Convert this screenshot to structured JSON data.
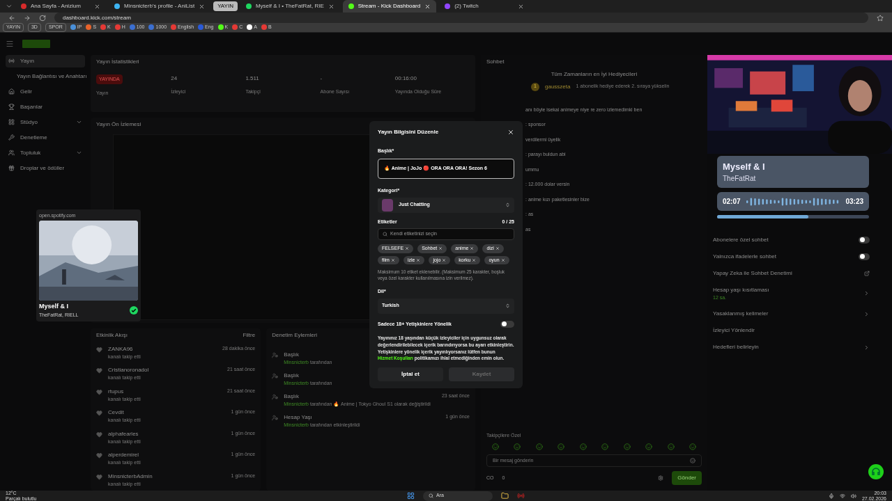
{
  "browser": {
    "tabs": [
      {
        "title": "Ana Sayfa - Anizium",
        "selected": false,
        "color": "#d62b2b"
      },
      {
        "title": "Minsnicterb's profile - AniList",
        "selected": false,
        "color": "#3db4f2"
      },
      {
        "title": "YAYIN",
        "kind": "group",
        "selected": false,
        "color": "#bbbbbb"
      },
      {
        "title": "Myself & I • TheFatRat, RIE",
        "selected": false,
        "color": "#1ed760"
      },
      {
        "title": "Stream - Kick Dashboard",
        "selected": true,
        "color": "#53fc18"
      },
      {
        "title": "(2) Twitch",
        "selected": false,
        "color": "#9146ff"
      }
    ],
    "address": "dashboard.kick.com/stream",
    "bookmarks": [
      {
        "label": "YAYIN",
        "kind": "folder"
      },
      {
        "label": "3D",
        "kind": "folder"
      },
      {
        "label": "SPOR",
        "kind": "folder"
      },
      {
        "label": "IP",
        "kind": "site",
        "color": "#4a90d9"
      },
      {
        "label": "S",
        "kind": "site",
        "color": "#e8632b"
      },
      {
        "label": "K",
        "kind": "site",
        "color": "#e53935"
      },
      {
        "label": "H",
        "kind": "site",
        "color": "#e53935"
      },
      {
        "label": "100",
        "kind": "site",
        "color": "#3b6fd1"
      },
      {
        "label": "1000",
        "kind": "site",
        "color": "#3b6fd1"
      },
      {
        "label": "English",
        "kind": "site",
        "color": "#e53935"
      },
      {
        "label": "Eng",
        "kind": "site",
        "color": "#2a5ad8"
      },
      {
        "label": "K",
        "kind": "site",
        "color": "#53fc18"
      },
      {
        "label": "C",
        "kind": "site",
        "color": "#e53935"
      },
      {
        "label": "A",
        "kind": "site",
        "color": "#ffffff"
      },
      {
        "label": "B",
        "kind": "site",
        "color": "#e53935"
      }
    ]
  },
  "sidebar": {
    "items": [
      {
        "label": "Yayın",
        "selected": true,
        "indent": false
      },
      {
        "label": "Yayın Bağlantısı ve Anahtarı",
        "selected": false,
        "indent": true
      },
      {
        "label": "Gelir",
        "selected": false,
        "indent": false
      },
      {
        "label": "Başarılar",
        "selected": false,
        "indent": false
      },
      {
        "label": "Stüdyo",
        "selected": false,
        "indent": false,
        "expandable": true
      },
      {
        "label": "Denetleme",
        "selected": false,
        "indent": false
      },
      {
        "label": "Topluluk",
        "selected": false,
        "indent": false,
        "expandable": true
      },
      {
        "label": "Droplar ve ödüller",
        "selected": false,
        "indent": false
      }
    ]
  },
  "stats": {
    "title": "Yayın İstatistikleri",
    "items": [
      {
        "value": "YAYINDA",
        "label": "Yayın",
        "kind": "badge"
      },
      {
        "value": "24",
        "label": "İzleyici",
        "kind": "number"
      },
      {
        "value": "1.511",
        "label": "Takipçi",
        "kind": "number"
      },
      {
        "value": "-",
        "label": "Abone Sayısı",
        "kind": "number"
      },
      {
        "value": "00:16:00",
        "label": "Yayında Olduğu Süre",
        "kind": "number"
      }
    ]
  },
  "preview": {
    "title": "Yayın Ön İzlemesi"
  },
  "mini_player": {
    "site": "open.spotify.com",
    "title": "Myself & I",
    "artist": "TheFatRat, RIELL"
  },
  "activity": {
    "title": "Etkinlik Akışı",
    "filter": "Filtre",
    "items": [
      {
        "name": "ZANKA96",
        "action": "kanalı takip etti",
        "time": "28 dakika önce"
      },
      {
        "name": "Cristianoronadol",
        "action": "kanalı takip etti",
        "time": "21 saat önce"
      },
      {
        "name": "rtupus",
        "action": "kanalı takip etti",
        "time": "21 saat önce"
      },
      {
        "name": "Cevdit",
        "action": "kanalı takip etti",
        "time": "1 gün önce"
      },
      {
        "name": "alphafearles",
        "action": "kanalı takip etti",
        "time": "1 gün önce"
      },
      {
        "name": "alperdemirel",
        "action": "kanalı takip etti",
        "time": "1 gün önce"
      },
      {
        "name": "MinsnicterbAdmin",
        "action": "kanalı takip etti",
        "time": "1 gün önce"
      }
    ]
  },
  "moderation": {
    "title": "Denetim Eylemleri",
    "items": [
      {
        "title": "Başlık",
        "user": "Minsnicterb",
        "detail": "tarafından"
      },
      {
        "title": "Başlık",
        "user": "Minsnicterb",
        "detail": "tarafından"
      },
      {
        "title": "Başlık",
        "user": "Minsnicterb",
        "detail": "tarafından 🔥 Anime | Tokyo Ghoul S1 olarak değiştirildi",
        "time": "23 saat önce"
      },
      {
        "title": "Hesap Yaşı",
        "user": "Minsnicterb",
        "detail": "tarafından etkinleştirildi",
        "time": "1 gün önce"
      }
    ]
  },
  "chat": {
    "title": "Sohbet",
    "leaderboard_title": "Tüm Zamanların en İyi Hediyecileri",
    "top_gifter": "gausszeta",
    "rank": "1",
    "gifter_hint": "1 abonelik hediye ederek 2. sıraya yükselin",
    "messages": [
      {
        "text": "anı böyle isekai animeye niye re zero izlemedimki ben"
      },
      {
        "text": ": sponsor"
      },
      {
        "text": "verdilermi üyelik"
      },
      {
        "text": ": parayı buldun abi"
      },
      {
        "text": "ummu"
      },
      {
        "text": ": 12.000 dolar versin"
      },
      {
        "text": ": anime kızı paketlesinler bize"
      },
      {
        "text": ": as"
      },
      {
        "text": "as"
      }
    ],
    "emote_label": "Takipçilere Özel",
    "input_placeholder": "Bir mesaj gönderin",
    "points": "CO",
    "count": "0",
    "send": "Gönder"
  },
  "overlay": {
    "song": "Myself & I",
    "artist": "TheFatRat",
    "elapsed": "02:07",
    "total": "03:23",
    "level": 0.6
  },
  "channel_actions": {
    "items": [
      {
        "label": "Abonelere özel sohbet",
        "kind": "toggle",
        "on": false
      },
      {
        "label": "Yalnızca ifadelerle sohbet",
        "kind": "toggle",
        "on": false
      },
      {
        "label": "Yapay Zeka ile Sohbet Denetimi",
        "kind": "external"
      },
      {
        "label": "Hesap yaşı kısıtlaması",
        "kind": "link",
        "sub": "12 sa."
      },
      {
        "label": "Yasaklanmış kelimeler",
        "kind": "link"
      },
      {
        "label": "İzleyici Yönlendir",
        "kind": "plain"
      },
      {
        "label": "Hedefleri belirleyin",
        "kind": "link"
      }
    ]
  },
  "modal": {
    "title": "Yayın Bilgisini Düzenle",
    "title_label": "Başlık*",
    "title_value": "🔥 Anime | JoJo 🔴 ORA ORA ORA! Sezon 6",
    "category_label": "Kategori*",
    "category": "Just Chatting",
    "tags_label": "Etiketler",
    "tags_count": "0 / 25",
    "tags_placeholder": "Kendi etiketinizi seçin",
    "tags": [
      "FELSEFE",
      "Sohbet",
      "anime",
      "dizi",
      "film",
      "izle",
      "jojo",
      "korku",
      "oyun"
    ],
    "tags_hint": "Maksimum 10 etiket eklenebilir. (Maksimum 25 karakter, boşluk veya özel karakter kullanılmasına izin verilmez).",
    "language_label": "Dil*",
    "language": "Turkish",
    "adult_label": "Sadece 18+ Yetişkinlere Yönelik",
    "adult_on": false,
    "adult_text": "Yayınınız 18 yaşından küçük izleyiciler için uygunsuz olarak değerlendirilebilecek içerik barındırıyorsa bu ayarı etkinleştirin. Yetişkinlere yönelik içerik yayınlıyorsanız lütfen bunun",
    "adult_link": "Hizmet Koşulları",
    "adult_text_end": "politikamızı ihlal etmediğinden emin olun.",
    "cancel": "İptal et",
    "save": "Kaydet",
    "save_disabled": true
  },
  "taskbar": {
    "temperature": "12°C",
    "weather": "Parçalı bulutlu",
    "search": "Ara",
    "time": "20:03",
    "date": "27.02.2026"
  }
}
